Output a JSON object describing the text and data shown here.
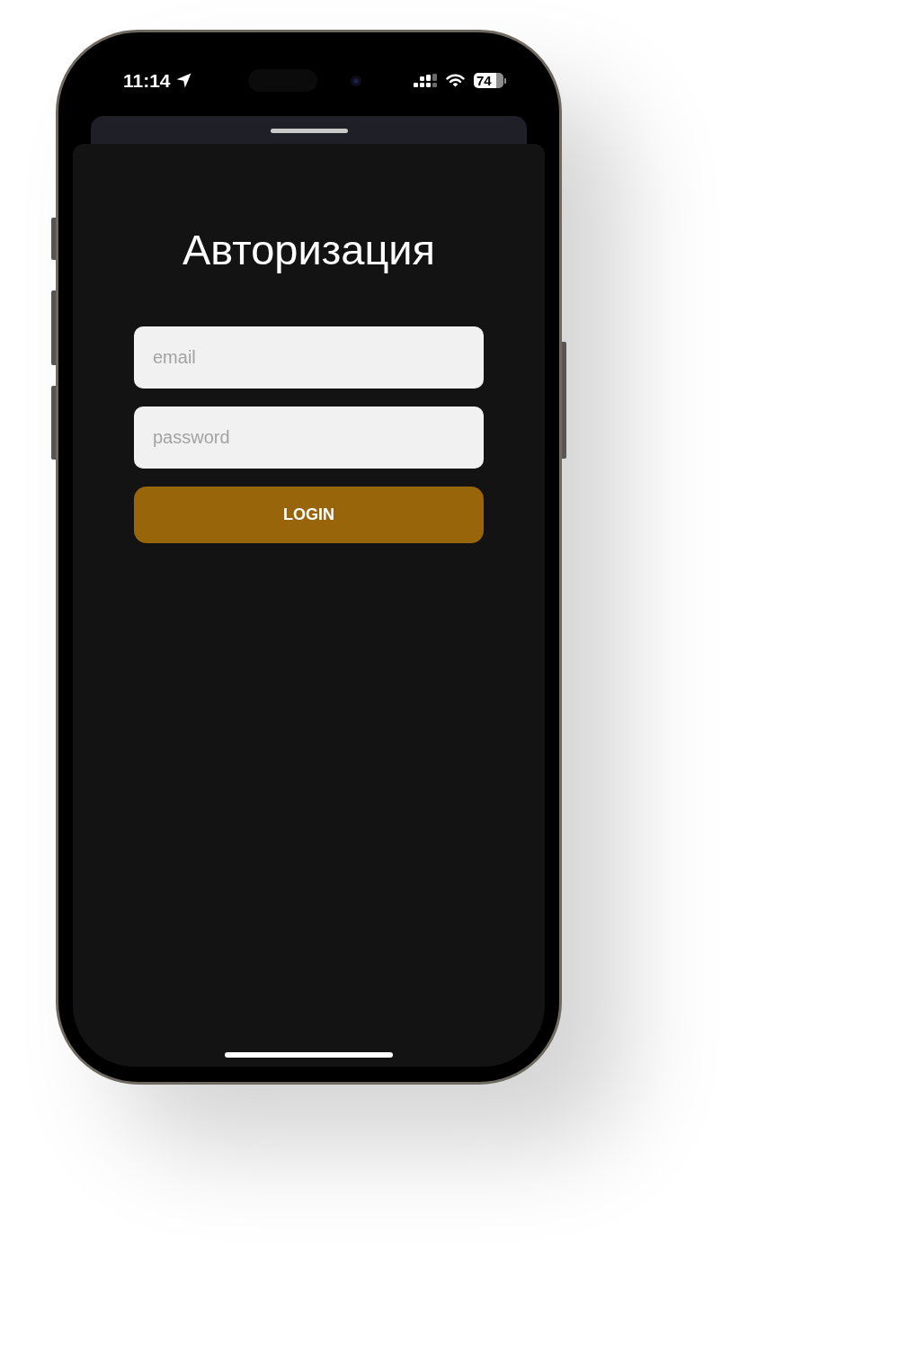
{
  "status_bar": {
    "time": "11:14",
    "battery": "74"
  },
  "sheet": {
    "title": "Авторизация",
    "fields": [
      {
        "placeholder": "email"
      },
      {
        "placeholder": "password"
      }
    ],
    "button": "LOGIN"
  }
}
